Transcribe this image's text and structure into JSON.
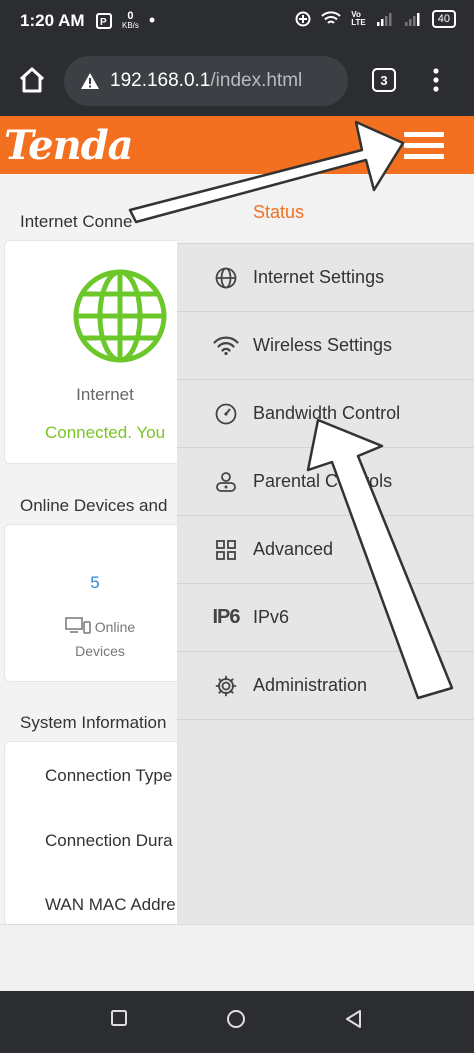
{
  "status_bar": {
    "time": "1:20 AM",
    "net_speed_top": "0",
    "net_speed_unit": "KB/s",
    "network_label_top": "Vo",
    "network_label_bottom": "LTE",
    "battery": "40"
  },
  "browser": {
    "url_host": "192.168.0.1",
    "url_path": "/index.html",
    "tab_count": "3"
  },
  "header": {
    "logo_text": "Tenda",
    "brand_color": "#f37021"
  },
  "dashboard": {
    "internet_section_title": "Internet Conne",
    "internet_label": "Internet",
    "internet_status": "Connected. You",
    "devices_section_title": "Online Devices and",
    "online_count": "5",
    "online_label": "Online",
    "devices_label": "Devices",
    "system_section_title": "System Information",
    "system_rows": [
      "Connection Type",
      "Connection Dura",
      "WAN MAC Addre"
    ]
  },
  "side_menu": {
    "items": [
      {
        "label": "Status",
        "icon": "status-icon",
        "active": true
      },
      {
        "label": "Internet Settings",
        "icon": "globe-icon"
      },
      {
        "label": "Wireless Settings",
        "icon": "wifi-icon"
      },
      {
        "label": "Bandwidth Control",
        "icon": "gauge-icon"
      },
      {
        "label": "Parental Controls",
        "icon": "parental-icon"
      },
      {
        "label": "Advanced",
        "icon": "grid-icon"
      },
      {
        "label": "IPv6",
        "icon": "ipv6-icon",
        "icon_text": "IP6"
      },
      {
        "label": "Administration",
        "icon": "gear-icon"
      }
    ]
  }
}
